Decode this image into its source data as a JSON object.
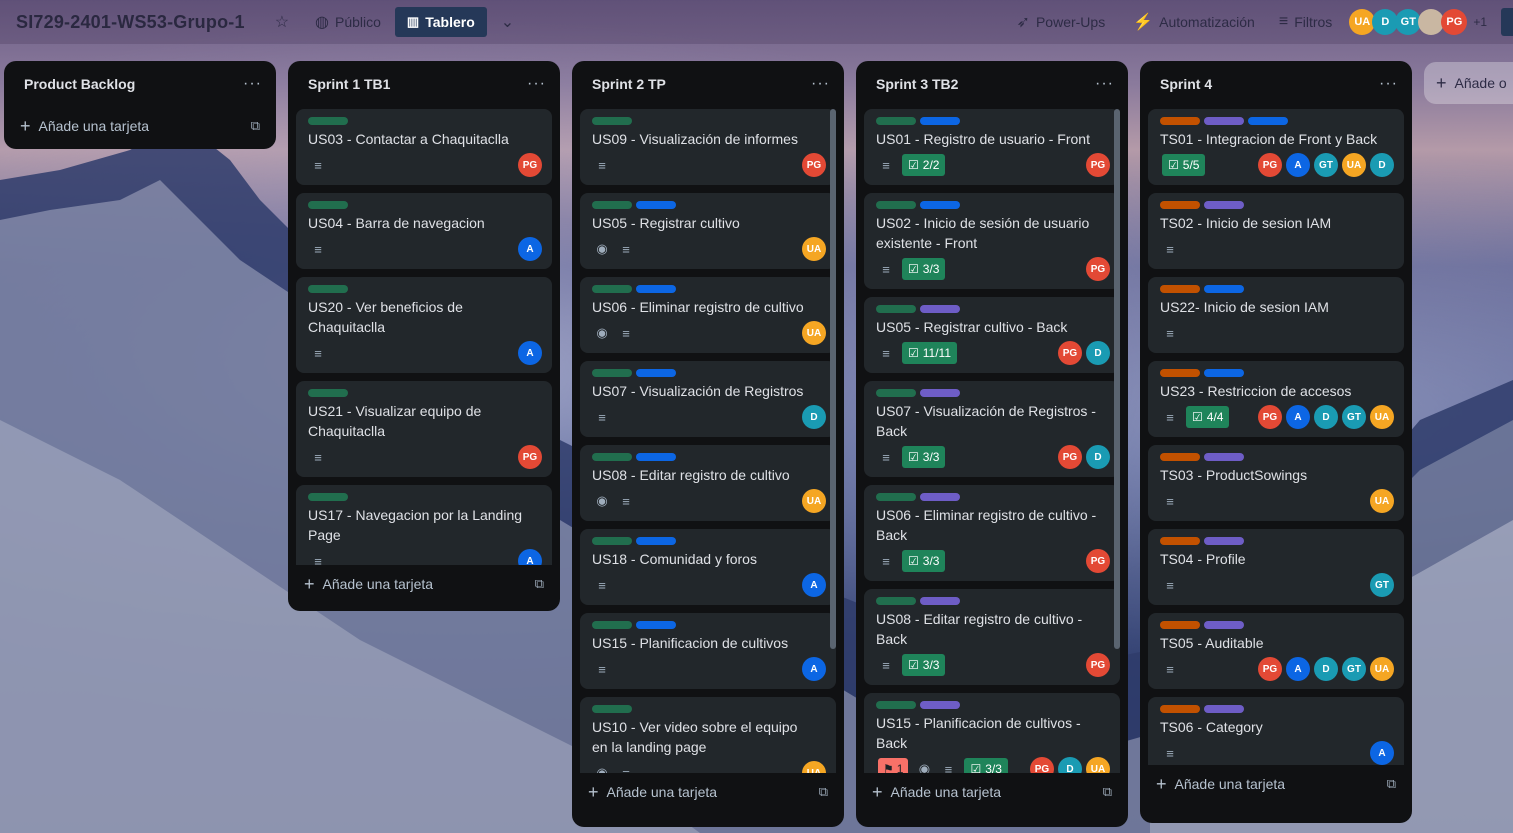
{
  "header": {
    "board_title": "SI729-2401-WS53-Grupo-1",
    "visibility_label": "Público",
    "view_label": "Tablero",
    "powerups_label": "Power-Ups",
    "automation_label": "Automatización",
    "filters_label": "Filtros",
    "members": [
      {
        "initials": "UA",
        "color": "#f5a623"
      },
      {
        "initials": "D",
        "color": "#1a9bb3"
      },
      {
        "initials": "GT",
        "color": "#1a9bb3"
      },
      {
        "initials": "",
        "color": "#c9b7a2"
      },
      {
        "initials": "PG",
        "color": "#e34935"
      }
    ],
    "extra_members": "+1"
  },
  "colors": {
    "green": "#216e4e",
    "blue": "#0c66e4",
    "purple": "#6e5dc6",
    "orange": "#c25100",
    "PG": "#e34935",
    "A": "#0c66e4",
    "D": "#1a9bb3",
    "UA": "#f5a623",
    "GT": "#1a9bb3"
  },
  "add_card_label": "Añade una tarjeta",
  "add_list_label": "Añade o",
  "lists": [
    {
      "title": "Product Backlog",
      "cards": []
    },
    {
      "title": "Sprint 1 TB1",
      "cards": [
        {
          "title": "US03 - Contactar a Chaquitaclla",
          "labels": [
            "green"
          ],
          "badges": [
            "desc"
          ],
          "checklist": "",
          "members": [
            "PG"
          ]
        },
        {
          "title": "US04 - Barra de navegacion",
          "labels": [
            "green"
          ],
          "badges": [
            "desc"
          ],
          "checklist": "",
          "members": [
            "A"
          ]
        },
        {
          "title": "US20 - Ver beneficios de Chaquitaclla",
          "labels": [
            "green"
          ],
          "badges": [
            "desc"
          ],
          "checklist": "",
          "members": [
            "A"
          ]
        },
        {
          "title": "US21 - Visualizar equipo de Chaquitaclla",
          "labels": [
            "green"
          ],
          "badges": [
            "desc"
          ],
          "checklist": "",
          "members": [
            "PG"
          ]
        },
        {
          "title": "US17 - Navegacion por la Landing Page",
          "labels": [
            "green"
          ],
          "badges": [
            "desc"
          ],
          "checklist": "",
          "members": [
            "A"
          ]
        }
      ]
    },
    {
      "title": "Sprint 2 TP",
      "cards": [
        {
          "title": "US09 - Visualización de informes",
          "labels": [
            "green"
          ],
          "badges": [
            "desc"
          ],
          "checklist": "",
          "members": [
            "PG"
          ]
        },
        {
          "title": "US05 - Registrar cultivo",
          "labels": [
            "green",
            "blue"
          ],
          "badges": [
            "watch",
            "desc"
          ],
          "checklist": "",
          "members": [
            "UA"
          ]
        },
        {
          "title": "US06 - Eliminar registro de cultivo",
          "labels": [
            "green",
            "blue"
          ],
          "badges": [
            "watch",
            "desc"
          ],
          "checklist": "",
          "members": [
            "UA"
          ]
        },
        {
          "title": "US07 - Visualización de Registros",
          "labels": [
            "green",
            "blue"
          ],
          "badges": [
            "desc"
          ],
          "checklist": "",
          "members": [
            "D"
          ]
        },
        {
          "title": "US08 - Editar registro de cultivo",
          "labels": [
            "green",
            "blue"
          ],
          "badges": [
            "watch",
            "desc"
          ],
          "checklist": "",
          "members": [
            "UA"
          ]
        },
        {
          "title": "US18 - Comunidad y foros",
          "labels": [
            "green",
            "blue"
          ],
          "badges": [
            "desc"
          ],
          "checklist": "",
          "members": [
            "A"
          ]
        },
        {
          "title": "US15 - Planificacion de cultivos",
          "labels": [
            "green",
            "blue"
          ],
          "badges": [
            "desc"
          ],
          "checklist": "",
          "members": [
            "A"
          ]
        },
        {
          "title": "US10 - Ver video sobre el equipo en la landing page",
          "labels": [
            "green"
          ],
          "badges": [
            "watch",
            "desc"
          ],
          "checklist": "",
          "members": [
            "UA"
          ]
        }
      ]
    },
    {
      "title": "Sprint 3 TB2",
      "cards": [
        {
          "title": "US01 - Registro de usuario - Front",
          "labels": [
            "green",
            "blue"
          ],
          "badges": [
            "desc"
          ],
          "checklist": "2/2",
          "members": [
            "PG"
          ]
        },
        {
          "title": "US02 - Inicio de sesión de usuario existente - Front",
          "labels": [
            "green",
            "blue"
          ],
          "badges": [
            "desc"
          ],
          "checklist": "3/3",
          "members": [
            "PG"
          ]
        },
        {
          "title": "US05 - Registrar cultivo - Back",
          "labels": [
            "green",
            "purple"
          ],
          "badges": [
            "desc"
          ],
          "checklist": "11/11",
          "members": [
            "PG",
            "D"
          ]
        },
        {
          "title": "US07 - Visualización de Registros - Back",
          "labels": [
            "green",
            "purple"
          ],
          "badges": [
            "desc"
          ],
          "checklist": "3/3",
          "members": [
            "PG",
            "D"
          ]
        },
        {
          "title": "US06 - Eliminar registro de cultivo - Back",
          "labels": [
            "green",
            "purple"
          ],
          "badges": [
            "desc"
          ],
          "checklist": "3/3",
          "members": [
            "PG"
          ]
        },
        {
          "title": "US08 - Editar registro de cultivo - Back",
          "labels": [
            "green",
            "purple"
          ],
          "badges": [
            "desc"
          ],
          "checklist": "3/3",
          "members": [
            "PG"
          ]
        },
        {
          "title": "US15 - Planificacion de cultivos - Back",
          "labels": [
            "green",
            "purple"
          ],
          "badges": [
            "alert",
            "watch",
            "desc"
          ],
          "alert": "1",
          "checklist": "3/3",
          "members": [
            "PG",
            "D",
            "UA"
          ]
        }
      ]
    },
    {
      "title": "Sprint 4",
      "cards": [
        {
          "title": "TS01 - Integracion de Front y Back",
          "labels": [
            "orange",
            "purple",
            "blue"
          ],
          "badges": [],
          "checklist": "5/5",
          "members": [
            "PG",
            "A",
            "GT",
            "UA",
            "D"
          ]
        },
        {
          "title": "TS02 - Inicio de sesion IAM",
          "labels": [
            "orange",
            "purple"
          ],
          "badges": [
            "desc"
          ],
          "checklist": "",
          "members": []
        },
        {
          "title": "US22- Inicio de sesion IAM",
          "labels": [
            "orange",
            "blue"
          ],
          "badges": [
            "desc"
          ],
          "checklist": "",
          "members": []
        },
        {
          "title": "US23 - Restriccion de accesos",
          "labels": [
            "orange",
            "blue"
          ],
          "badges": [
            "desc"
          ],
          "checklist": "4/4",
          "members": [
            "PG",
            "A",
            "D",
            "GT",
            "UA"
          ]
        },
        {
          "title": "TS03 - ProductSowings",
          "labels": [
            "orange",
            "purple"
          ],
          "badges": [
            "desc"
          ],
          "checklist": "",
          "members": [
            "UA"
          ]
        },
        {
          "title": "TS04 - Profile",
          "labels": [
            "orange",
            "purple"
          ],
          "badges": [
            "desc"
          ],
          "checklist": "",
          "members": [
            "GT"
          ]
        },
        {
          "title": "TS05 - Auditable",
          "labels": [
            "orange",
            "purple"
          ],
          "badges": [
            "desc"
          ],
          "checklist": "",
          "members": [
            "PG",
            "A",
            "D",
            "GT",
            "UA"
          ]
        },
        {
          "title": "TS06 - Category",
          "labels": [
            "orange",
            "purple"
          ],
          "badges": [
            "desc"
          ],
          "checklist": "",
          "members": [
            "A"
          ]
        }
      ]
    }
  ]
}
